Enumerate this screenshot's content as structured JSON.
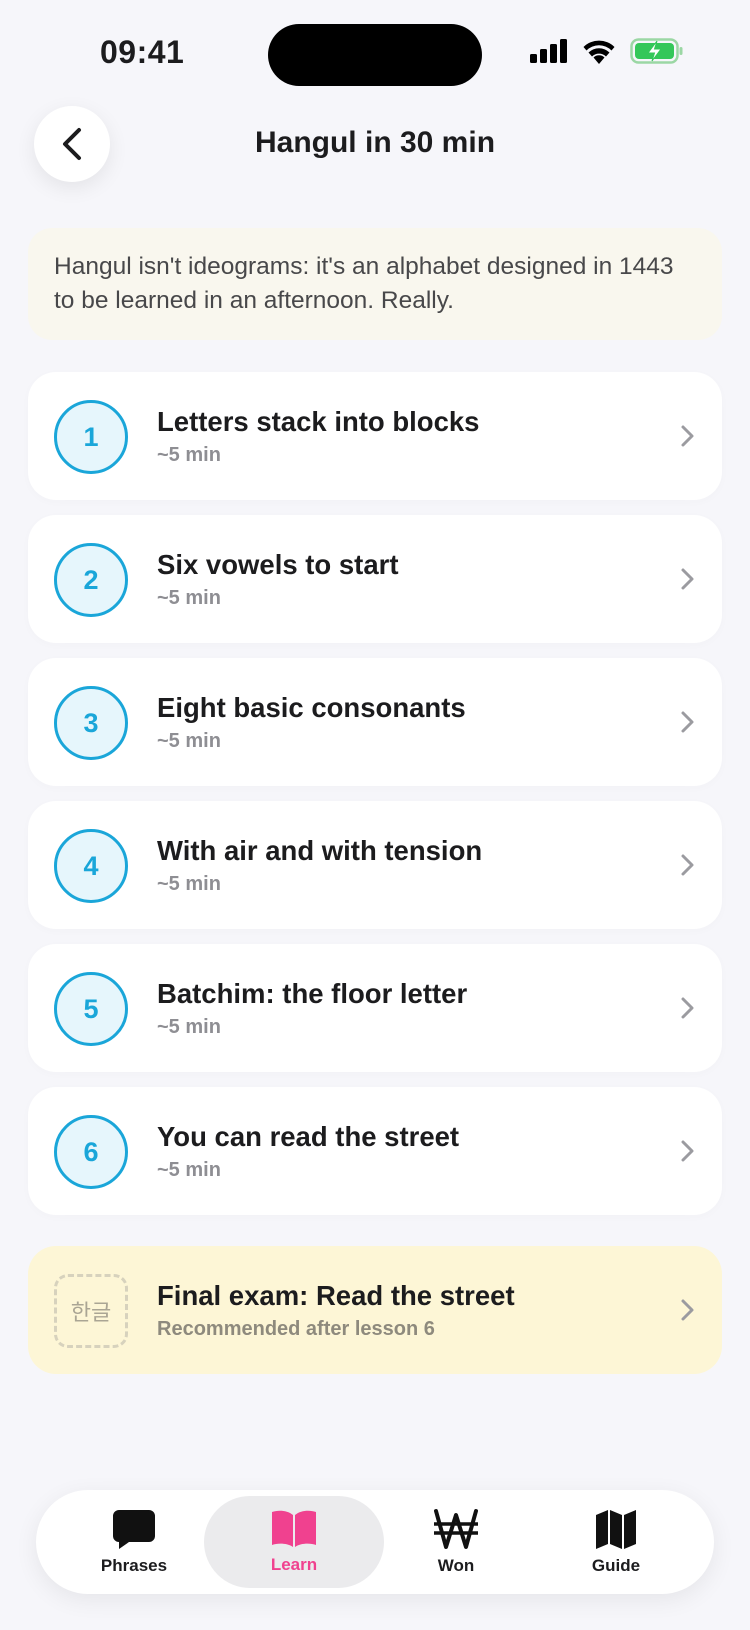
{
  "status_bar": {
    "time": "09:41"
  },
  "header": {
    "title": "Hangul in 30 min"
  },
  "intro": {
    "text": "Hangul isn't ideograms: it's an alphabet designed in 1443 to be learned in an afternoon. Really."
  },
  "lessons": [
    {
      "number": "1",
      "title": "Letters stack into blocks",
      "duration": "~5 min"
    },
    {
      "number": "2",
      "title": "Six vowels to start",
      "duration": "~5 min"
    },
    {
      "number": "3",
      "title": "Eight basic consonants",
      "duration": "~5 min"
    },
    {
      "number": "4",
      "title": "With air and with tension",
      "duration": "~5 min"
    },
    {
      "number": "5",
      "title": "Batchim: the floor letter",
      "duration": "~5 min"
    },
    {
      "number": "6",
      "title": "You can read the street",
      "duration": "~5 min"
    }
  ],
  "exam": {
    "badge": "한글",
    "title": "Final exam: Read the street",
    "subtitle": "Recommended after lesson 6"
  },
  "tabs": [
    {
      "label": "Phrases",
      "icon": "speech-bubble-icon",
      "active": false
    },
    {
      "label": "Learn",
      "icon": "open-book-icon",
      "active": true
    },
    {
      "label": "Won",
      "icon": "won-sign-icon",
      "active": false
    },
    {
      "label": "Guide",
      "icon": "map-icon",
      "active": false
    }
  ],
  "colors": {
    "accent_blue": "#1aa6d9",
    "accent_pink": "#f0418f",
    "intro_bg": "#f9f7ee",
    "exam_bg": "#fdf6d6",
    "battery_green": "#34c759"
  }
}
